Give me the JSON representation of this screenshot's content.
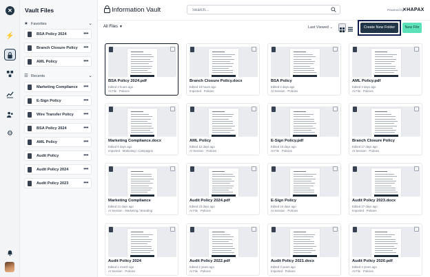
{
  "rail": {
    "logo_icon": "hapax-logo-icon",
    "items": [
      {
        "name": "bolt-icon",
        "glyph": "⚡"
      },
      {
        "name": "lock-icon",
        "glyph": "lock",
        "active": true
      },
      {
        "name": "workflow-icon",
        "glyph": "workflow"
      },
      {
        "name": "chart-icon",
        "glyph": "chart"
      },
      {
        "name": "users-icon",
        "glyph": "users"
      },
      {
        "name": "gear-icon",
        "glyph": "⚙"
      }
    ],
    "bell_icon": "bell-icon"
  },
  "sidebar": {
    "title": "Vault Files",
    "favorites_label": "Favorites",
    "favorites": [
      "BSA Policy 2024",
      "Branch Closure Policy",
      "AML Policy"
    ],
    "recents_label": "Recents",
    "recents": [
      "Marketing Compliance",
      "E-Sign Policy",
      "Wire Transfer Policy",
      "BSA Policy 2024",
      "AML Policy",
      "Audit Policy",
      "Audit Policy 2024",
      "Audit Policy 2023"
    ]
  },
  "header": {
    "title": "Information Vault",
    "search_placeholder": "Search...",
    "powered_by": "Powered by",
    "brand": "HAPAX"
  },
  "toolbar": {
    "filter_label": "All Files",
    "sort_label": "Last Viewed",
    "create_folder_label": "Create New Folder",
    "new_file_label": "New File"
  },
  "files": [
    {
      "name": "BSA Policy 2024.pdf",
      "edited": "Edited 2 hours ago",
      "source": "AI File · Policies",
      "selected": true
    },
    {
      "name": "Branch Closure Policy.docx",
      "edited": "Edited 10 hours ago",
      "source": "Imported · Policies"
    },
    {
      "name": "BSA Policy",
      "edited": "Edited 2 days ago",
      "source": "AI Session · Policies"
    },
    {
      "name": "AML Policy.pdf",
      "edited": "Edited 3 days ago",
      "source": "AI File · Policies"
    },
    {
      "name": "Marketing Compliance.docx",
      "edited": "Edited 6 days ago",
      "source": "Imported · Marketing / Campaigns"
    },
    {
      "name": "AML Policy",
      "edited": "Edited 12 days ago",
      "source": "AI Session · Policies"
    },
    {
      "name": "E-Sign Policy.pdf",
      "edited": "Edited 15 days ago",
      "source": "AI File · Policies"
    },
    {
      "name": "Branch Closure Policy",
      "edited": "Edited 17 days ago",
      "source": "AI Session · Policies"
    },
    {
      "name": "Marketing Compliance",
      "edited": "Edited 21 days ago",
      "source": "AI Session · Marketing / Branding"
    },
    {
      "name": "Audit Policy 2024.pdf",
      "edited": "Edited 23 days ago",
      "source": "AI File · Policies"
    },
    {
      "name": "E-Sign Policy",
      "edited": "Edited 24 days ago",
      "source": "AI Session · Policies"
    },
    {
      "name": "Audit Policy 2023.docx",
      "edited": "Edited 27 days ago",
      "source": "Imported · Policies"
    },
    {
      "name": "Audit Policy 2024",
      "edited": "Edited 1 month ago",
      "source": "AI Session · Policies"
    },
    {
      "name": "Audit Policy 2022.pdf",
      "edited": "Edited 2 years ago",
      "source": "AI File · Policies"
    },
    {
      "name": "Audit Policy 2021.docx",
      "edited": "Edited 3 years ago",
      "source": "Imported · Policies"
    },
    {
      "name": "Audit Policy 2020.pdf",
      "edited": "Edited 4 years ago",
      "source": "AI File · Policies"
    }
  ],
  "colors": {
    "primary": "#213547",
    "accent": "#5ce1b8",
    "focus_outline": "#0b1c4d"
  }
}
